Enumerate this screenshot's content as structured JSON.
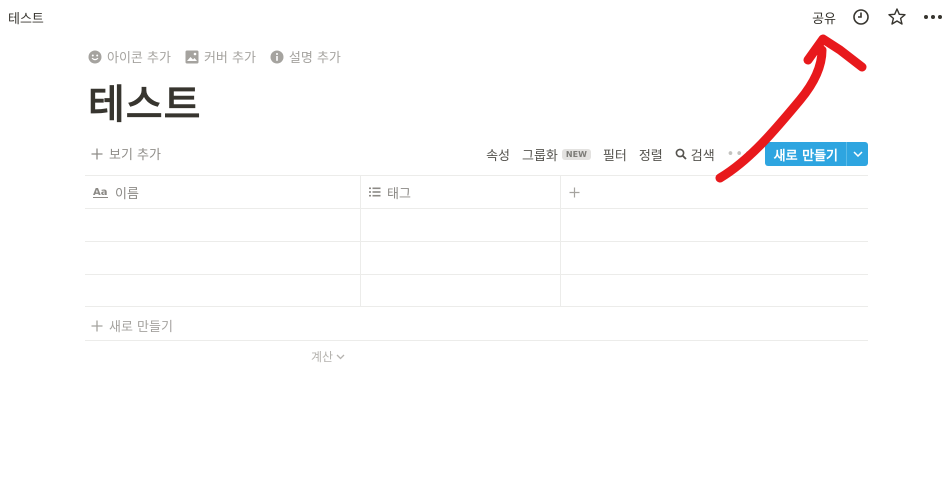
{
  "topbar": {
    "breadcrumb": "테스트",
    "share_label": "공유",
    "icons": [
      "clock-icon",
      "star-icon",
      "more-icon"
    ]
  },
  "page": {
    "actions": [
      {
        "icon": "smiley-icon",
        "label": "아이콘 추가"
      },
      {
        "icon": "image-icon",
        "label": "커버 추가"
      },
      {
        "icon": "info-icon",
        "label": "설명 추가"
      }
    ],
    "title": "테스트"
  },
  "view_bar": {
    "add_view_label": "보기 추가",
    "properties_label": "속성",
    "group_label": "그룹화",
    "new_badge": "NEW",
    "filter_label": "필터",
    "sort_label": "정렬",
    "search_label": "검색",
    "more_dots": "•••",
    "new_button_label": "새로 만들기"
  },
  "table": {
    "columns": [
      {
        "icon": "text-type-icon",
        "label": "이름"
      },
      {
        "icon": "list-icon",
        "label": "태그"
      }
    ],
    "add_column_glyph": "+",
    "rows": [
      [
        "",
        ""
      ],
      [
        "",
        ""
      ],
      [
        "",
        ""
      ]
    ]
  },
  "footer": {
    "add_row_label": "새로 만들기",
    "calculate_label": "계산"
  },
  "annotation": {
    "arrow_color": "#e8191c"
  }
}
